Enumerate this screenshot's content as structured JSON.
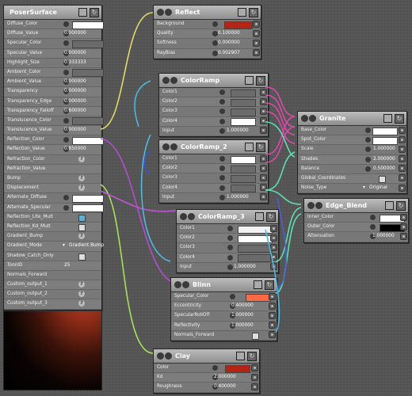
{
  "colors": {
    "red": "#b52515",
    "white": "#ffffff",
    "gray": "#6b6b6b",
    "black": "#000000",
    "salmon": "#ff6a45"
  },
  "poser": {
    "title": "PoserSurface",
    "rows": [
      {
        "label": "Diffuse_Color",
        "type": "swatch",
        "color": "#ffffff"
      },
      {
        "label": "Diffuse_Value",
        "type": "num",
        "value": "0.000000"
      },
      {
        "label": "Specular_Color",
        "type": "swatch",
        "color": "#6b6b6b"
      },
      {
        "label": "Specular_Value",
        "type": "num",
        "value": "0.000000"
      },
      {
        "label": "Highlight_Size",
        "type": "num",
        "value": "0.333333"
      },
      {
        "label": "Ambient_Color",
        "type": "swatch",
        "color": "#6b6b6b"
      },
      {
        "label": "Ambient_Value",
        "type": "num",
        "value": "0.000000"
      },
      {
        "label": "Transparency",
        "type": "num",
        "value": "0.000000"
      },
      {
        "label": "Transparency_Edge",
        "type": "num",
        "value": "0.000000"
      },
      {
        "label": "Transparency_Falloff",
        "type": "num",
        "value": "0.600000"
      },
      {
        "label": "Translucence_Color",
        "type": "swatch",
        "color": "#6b6b6b"
      },
      {
        "label": "Translucence_Value",
        "type": "num",
        "value": "0.000000"
      },
      {
        "label": "Reflection_Color",
        "type": "swatch",
        "color": "#ffffff"
      },
      {
        "label": "Reflection_Value",
        "type": "num",
        "value": "0.850000"
      },
      {
        "label": "Refraction_Color",
        "type": "help"
      },
      {
        "label": "Refraction_Value",
        "type": "empty"
      },
      {
        "label": "Bump",
        "type": "help"
      },
      {
        "label": "Displacement",
        "type": "help"
      },
      {
        "label": "Alternate_Diffuse",
        "type": "swatch",
        "color": "#ffffff"
      },
      {
        "label": "Alternate_Specular",
        "type": "swatch",
        "color": "#ffffff"
      },
      {
        "label": "Reflection_Lite_Mult",
        "type": "check",
        "on": true
      },
      {
        "label": "Reflection_Kd_Mult",
        "type": "check",
        "on": false
      },
      {
        "label": "Gradient_Bump",
        "type": "help"
      },
      {
        "label": "Gradient_Mode",
        "type": "menu",
        "value": "Gradient Bump"
      },
      {
        "label": "Shadow_Catch_Only",
        "type": "check",
        "on": false
      },
      {
        "label": "ToonID",
        "type": "text",
        "value": "25"
      },
      {
        "label": "Normals_Forward",
        "type": "empty"
      },
      {
        "label": "Custom_output_1",
        "type": "help"
      },
      {
        "label": "Custom_output_2",
        "type": "help"
      },
      {
        "label": "Custom_output_3",
        "type": "help"
      }
    ]
  },
  "reflect": {
    "title": "Reflect",
    "rows": [
      {
        "label": "Background",
        "type": "swatch",
        "color": "#b52515"
      },
      {
        "label": "Quality",
        "type": "num",
        "value": "0.100000"
      },
      {
        "label": "Softness",
        "type": "num",
        "value": "0.000000"
      },
      {
        "label": "RayBias",
        "type": "num",
        "value": "0.002907"
      }
    ]
  },
  "colorramp": {
    "title": "ColorRamp",
    "rows": [
      {
        "label": "Color1",
        "type": "swatch",
        "color": "#6b6b6b"
      },
      {
        "label": "Color2",
        "type": "swatch",
        "color": "#6b6b6b"
      },
      {
        "label": "Color3",
        "type": "swatch",
        "color": "#6b6b6b"
      },
      {
        "label": "Color4",
        "type": "swatch",
        "color": "#ffffff"
      },
      {
        "label": "Input",
        "type": "num",
        "value": "1.000000"
      }
    ]
  },
  "colorramp2": {
    "title": "ColorRamp_2",
    "rows": [
      {
        "label": "Color1",
        "type": "swatch",
        "color": "#ffffff"
      },
      {
        "label": "Color2",
        "type": "swatch",
        "color": "#6b6b6b"
      },
      {
        "label": "Color3",
        "type": "swatch",
        "color": "#6b6b6b"
      },
      {
        "label": "Color4",
        "type": "swatch",
        "color": "#6b6b6b"
      },
      {
        "label": "Input",
        "type": "num",
        "value": "1.000000"
      }
    ]
  },
  "colorramp3": {
    "title": "ColorRamp_3",
    "rows": [
      {
        "label": "Color1",
        "type": "swatch",
        "color": "#f2f2f2"
      },
      {
        "label": "Color2",
        "type": "swatch",
        "color": "#ffffff"
      },
      {
        "label": "Color3",
        "type": "swatch",
        "color": "#6b6b6b"
      },
      {
        "label": "Color4",
        "type": "swatch",
        "color": "#6b6b6b"
      },
      {
        "label": "Input",
        "type": "num",
        "value": "1.000000"
      }
    ]
  },
  "granite": {
    "title": "Granite",
    "rows": [
      {
        "label": "Base_Color",
        "type": "swatch",
        "color": "#ffffff"
      },
      {
        "label": "Spot_Color",
        "type": "swatch",
        "color": "#ffffff"
      },
      {
        "label": "Scale",
        "type": "num",
        "value": "1.000000"
      },
      {
        "label": "Shades",
        "type": "num",
        "value": "2.000000"
      },
      {
        "label": "Balance",
        "type": "num",
        "value": "0.500000"
      },
      {
        "label": "Global_Coordinates",
        "type": "check",
        "on": false
      },
      {
        "label": "Noise_Type",
        "type": "menu",
        "value": "Original"
      }
    ]
  },
  "edge": {
    "title": "Edge_Blend",
    "rows": [
      {
        "label": "Inner_Color",
        "type": "swatch",
        "color": "#ffffff"
      },
      {
        "label": "Outer_Color",
        "type": "swatch",
        "color": "#000000"
      },
      {
        "label": "Attenuation",
        "type": "num",
        "value": "1.000000"
      }
    ]
  },
  "blinn": {
    "title": "Blinn",
    "rows": [
      {
        "label": "Specular_Color",
        "type": "swatch",
        "color": "#ff6a45"
      },
      {
        "label": "Eccentricity",
        "type": "num",
        "value": "0.400000"
      },
      {
        "label": "SpecularRollOff",
        "type": "num",
        "value": "1.000000"
      },
      {
        "label": "Reflectivity",
        "type": "num",
        "value": "1.000000"
      },
      {
        "label": "Normals_Forward",
        "type": "check",
        "on": false
      }
    ]
  },
  "clay": {
    "title": "Clay",
    "rows": [
      {
        "label": "Color",
        "type": "swatch",
        "color": "#b52515"
      },
      {
        "label": "Kd",
        "type": "num",
        "value": "2.000000"
      },
      {
        "label": "Roughness",
        "type": "num",
        "value": "0.400000"
      }
    ]
  }
}
